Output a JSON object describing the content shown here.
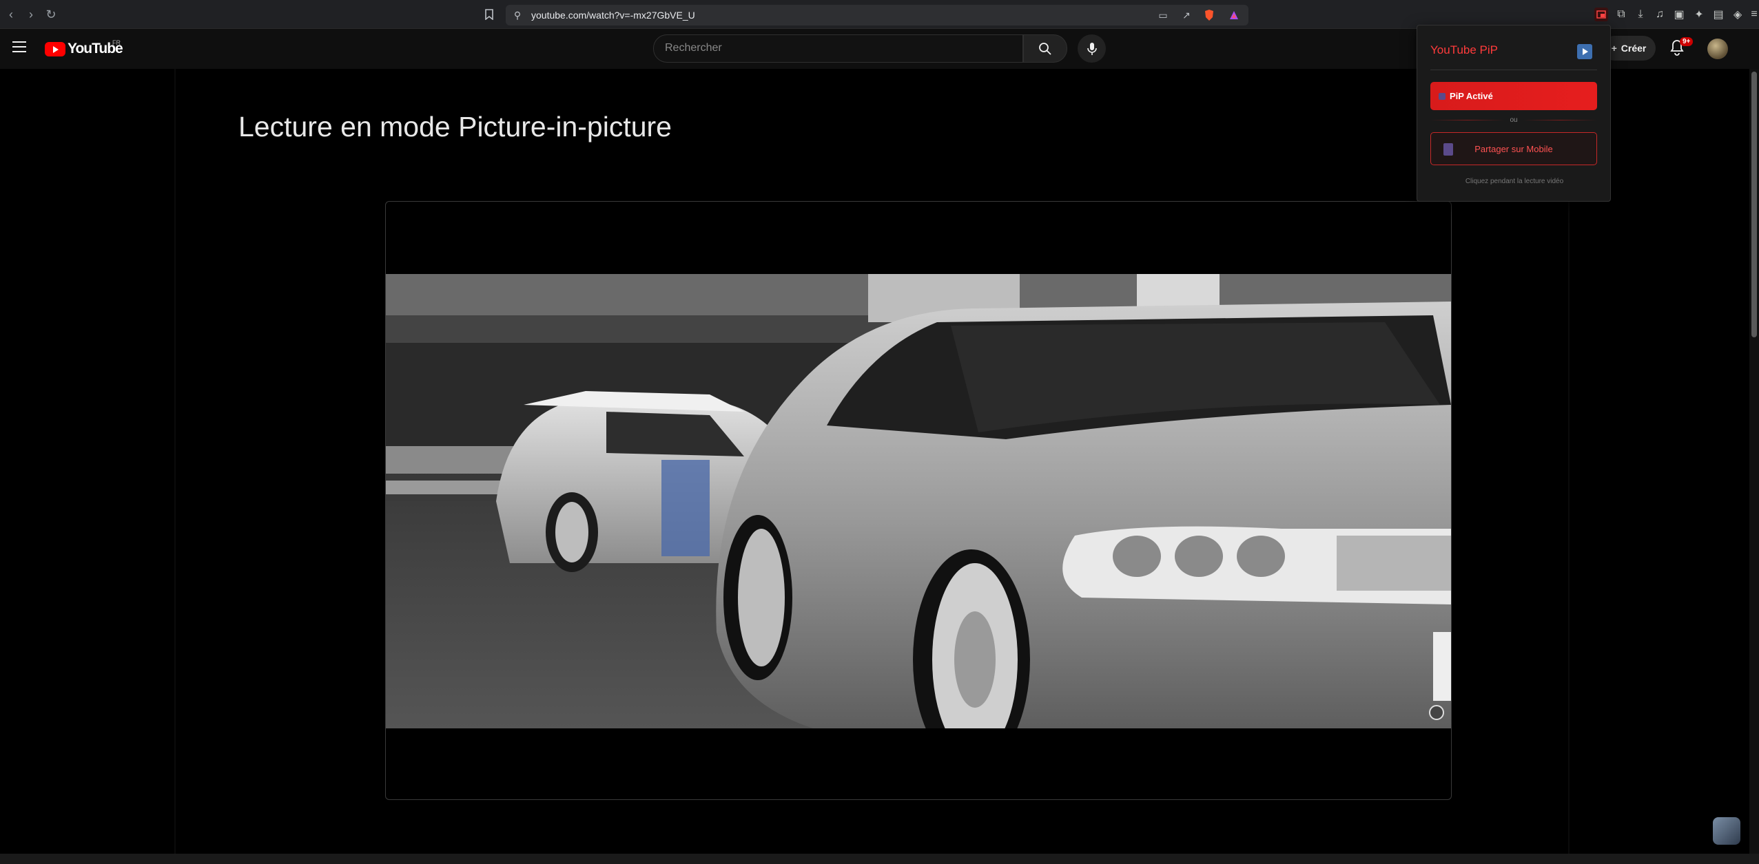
{
  "browser": {
    "url": "youtube.com/watch?v=-mx27GbVE_U",
    "icons": [
      "back-icon",
      "forward-icon",
      "reload-icon",
      "bookmark-icon",
      "site-info-icon",
      "cast-icon",
      "share-icon",
      "brave-shield-icon",
      "brave-rewards-icon",
      "pip-extension-icon",
      "extensions-icon",
      "download-icon",
      "media-icon",
      "leo-icon",
      "wallet-icon",
      "vpn-icon",
      "menu-icon"
    ]
  },
  "masthead": {
    "logo_text": "YouTube",
    "country_code": "FR",
    "search_placeholder": "Rechercher",
    "create_label": "Créer",
    "notification_count": "9+"
  },
  "main": {
    "title": "Lecture en mode Picture-in-picture"
  },
  "popup": {
    "title": "YouTube PiP",
    "pip_button_label": "PiP Activé",
    "separator_label": "ou",
    "share_button_label": "Partager sur Mobile",
    "hint": "Cliquez pendant la lecture vidéo"
  },
  "colors": {
    "brand_red": "#ff0000",
    "accent_red": "#e61e1e",
    "background": "#000000"
  }
}
